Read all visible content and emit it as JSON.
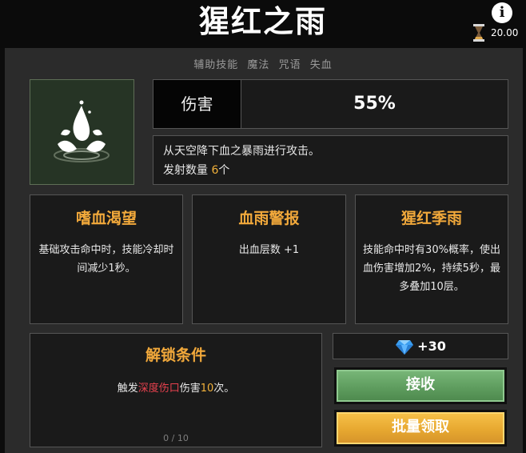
{
  "header": {
    "title": "猩红之雨",
    "info_icon": "i",
    "timer": "20.00"
  },
  "tags": [
    "辅助技能",
    "魔法",
    "咒语",
    "失血"
  ],
  "skill": {
    "icon": "blood-drop-splash-icon",
    "damage_label": "伤害",
    "damage_value": "55%",
    "description_line1": "从天空降下血之暴雨进行攻击。",
    "description_line2_prefix": "发射数量 ",
    "description_line2_value": "6",
    "description_line2_suffix": "个"
  },
  "cards": [
    {
      "title": "嗜血渴望",
      "text": "基础攻击命中时，技能冷却时间减少1秒。"
    },
    {
      "title": "血雨警报",
      "text": "出血层数 +1"
    },
    {
      "title": "猩红季雨",
      "text": "技能命中时有30%概率，使出血伤害增加2%，持续5秒，最多叠加10层。"
    }
  ],
  "unlock": {
    "title": "解锁条件",
    "text_prefix": "触发",
    "text_highlight": "深度伤口",
    "text_middle": "伤害",
    "text_count": "10",
    "text_suffix": "次。",
    "progress": "0 / 10"
  },
  "reward": {
    "icon": "diamond-icon",
    "amount": "+30"
  },
  "buttons": {
    "accept": "接收",
    "batch": "批量领取"
  },
  "colors": {
    "accent_orange": "#f2a93b",
    "highlight_red": "#e8414e",
    "accept_green": "#5f9d5f",
    "batch_gold": "#e7a830"
  }
}
